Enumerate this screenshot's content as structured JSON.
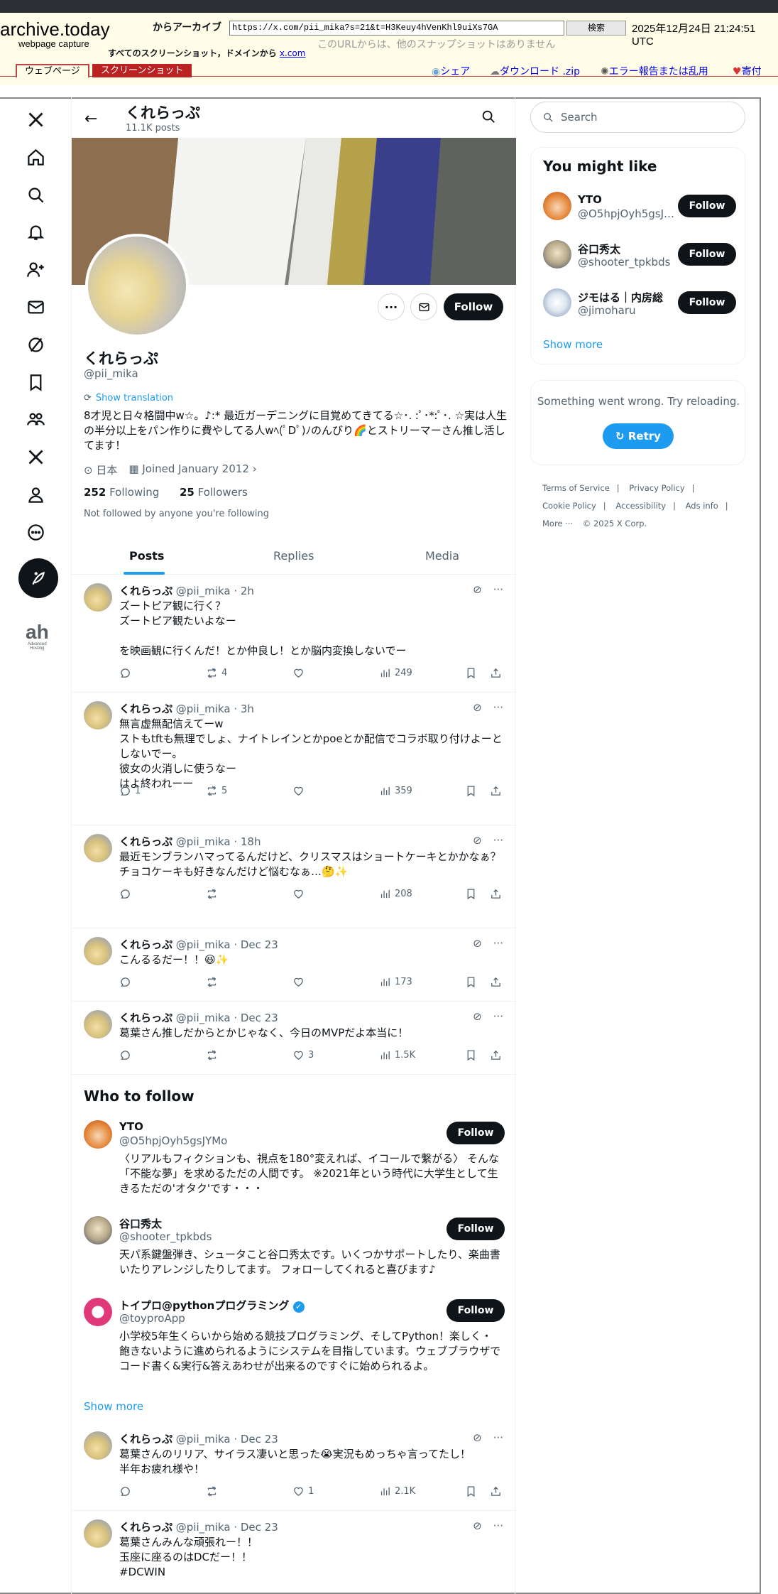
{
  "archive": {
    "logo": "archive.today",
    "subtitle": "webpage capture",
    "from_label": "からアーカイブ",
    "url": "https://x.com/pii_mika?s=21&t=H3Keuy4hVenKhl9uiXs7GA",
    "search_button": "検索",
    "date": "2025年12月24日 21:24:51 UTC",
    "no_snapshots": "このURLからは、他のスナップショットはありません",
    "all_shots_prefix": "すべてのスクリーンショット，ドメインから",
    "all_shots_domain": "x.com",
    "tab_webpage": "ウェブページ",
    "tab_screenshot": "スクリーンショット",
    "link_share": "シェア",
    "link_download": "ダウンロード .zip",
    "link_report": "エラー報告または乱用",
    "link_donate": "寄付"
  },
  "rail": {
    "advanced_label_big": "ah",
    "advanced_label_small1": "Advanced",
    "advanced_label_small2": "Hosting"
  },
  "header": {
    "name": "くれらっぷ",
    "posts_count": "11.1K posts"
  },
  "profile": {
    "name": "くれらっぷ",
    "handle": "@pii_mika",
    "translate": "Show translation",
    "bio": "8才児と日々格闘中w☆。♪:* 最近ガーデニングに目覚めてきてる☆･. :ﾟ･*:ﾟ･. ☆実は人生の半分以上をパン作りに費やしてる人wﾍ(ﾟDﾟ)ﾉのんびり🌈とストリーマーさん推し活してます！",
    "location": "日本",
    "joined": "Joined January 2012",
    "following_count": "252",
    "following_label": "Following",
    "followers_count": "25",
    "followers_label": "Followers",
    "not_followed": "Not followed by anyone you're following",
    "follow_button": "Follow"
  },
  "tabs": [
    "Posts",
    "Replies",
    "Media"
  ],
  "tweets": [
    {
      "name": "くれらっぷ",
      "meta": "@pii_mika · 2h",
      "text": "ズートピア観に行く？\nズートピア観たいよなー\n\nを映画観に行くんだ！とか仲良し！とか脳内変換しないでー",
      "reply": "",
      "retweet": "4",
      "like": "",
      "views": "249"
    },
    {
      "name": "くれらっぷ",
      "meta": "@pii_mika · 3h",
      "text": "無言虚無配信えてーw\nストもtftも無理でしょ、ナイトレインとかpoeとか配信でコラボ取り付けよーとしないでー。\n彼女の火消しに使うなー\nはよ終われーー",
      "reply": "1",
      "retweet": "5",
      "like": "",
      "views": "359"
    },
    {
      "name": "くれらっぷ",
      "meta": "@pii_mika · 18h",
      "text": "最近モンブランハマってるんだけど、クリスマスはショートケーキとかかなぁ？\nチョコケーキも好きなんだけど悩むなぁ…🤔✨",
      "reply": "",
      "retweet": "",
      "like": "",
      "views": "208"
    },
    {
      "name": "くれらっぷ",
      "meta": "@pii_mika · Dec 23",
      "text": "こんるるだー！！😆✨",
      "reply": "",
      "retweet": "",
      "like": "",
      "views": "173"
    },
    {
      "name": "くれらっぷ",
      "meta": "@pii_mika · Dec 23",
      "text": "葛葉さん推しだからとかじゃなく、今日のMVPだよ本当に！",
      "reply": "",
      "retweet": "",
      "like": "3",
      "views": "1.5K"
    },
    {
      "name": "くれらっぷ",
      "meta": "@pii_mika · Dec 23",
      "text": "葛葉さんのリリア、サイラス凄いと思った😭実況もめっちゃ言ってたし！\n半年お疲れ様や！",
      "reply": "",
      "retweet": "",
      "like": "1",
      "views": "2.1K"
    },
    {
      "name": "くれらっぷ",
      "meta": "@pii_mika · Dec 23",
      "text": "葛葉さんみんな頑張れー！！\n玉座に座るのはDCだー！！\n#DCWIN",
      "reply": "",
      "retweet": "",
      "like": "",
      "views": ""
    }
  ],
  "who_to_follow": {
    "title": "Who to follow",
    "show_more": "Show more",
    "follow_label": "Follow",
    "users": [
      {
        "name": "YTO",
        "handle": "@O5hpjOyh5gsJYMo",
        "bio": "〈リアルもフィクションも、視点を180°変えれば、イコールで繋がる〉 そんな「不能な夢」を求めるただの人間です。 ※2021年という時代に大学生として生きるただの'オタク'です・・・"
      },
      {
        "name": "谷口秀太",
        "handle": "@shooter_tpkbds",
        "bio": "天パ系鍵盤弾き、シュータこと谷口秀太です。いくつかサポートしたり、楽曲書いたりアレンジしたりしてます。 フォローしてくれると喜びます♪"
      },
      {
        "name": "トイプロ@pythonプログラミング",
        "handle": "@toyproApp",
        "bio": "小学校5年生くらいから始める競技プログラミング、そしてPython！楽しく・飽きないように進められるようにシステムを目指しています。ウェブブラウザでコード書く&実行&答えあわせが出来るのですぐに始められるよ。"
      }
    ]
  },
  "sidebar": {
    "search_placeholder": "Search",
    "might_like_title": "You might like",
    "follow_label": "Follow",
    "might_like": [
      {
        "name": "YTO",
        "handle": "@O5hpjOyh5gsJYMo"
      },
      {
        "name": "谷口秀太",
        "handle": "@shooter_tpkbds"
      },
      {
        "name": "ジモはる｜内房総",
        "handle": "@jimoharu"
      }
    ],
    "show_more": "Show more",
    "error_text": "Something went wrong. Try reloading.",
    "retry": "Retry",
    "footer": [
      "Terms of Service",
      "Privacy Policy",
      "Cookie Policy",
      "Accessibility",
      "Ads info",
      "More ···",
      "© 2025 X Corp."
    ]
  },
  "colors": {
    "accent": "#1d9bf0",
    "text": "#0f1419",
    "muted": "#536471",
    "archive_bg": "#fffde8",
    "archive_red": "#bb2222"
  }
}
